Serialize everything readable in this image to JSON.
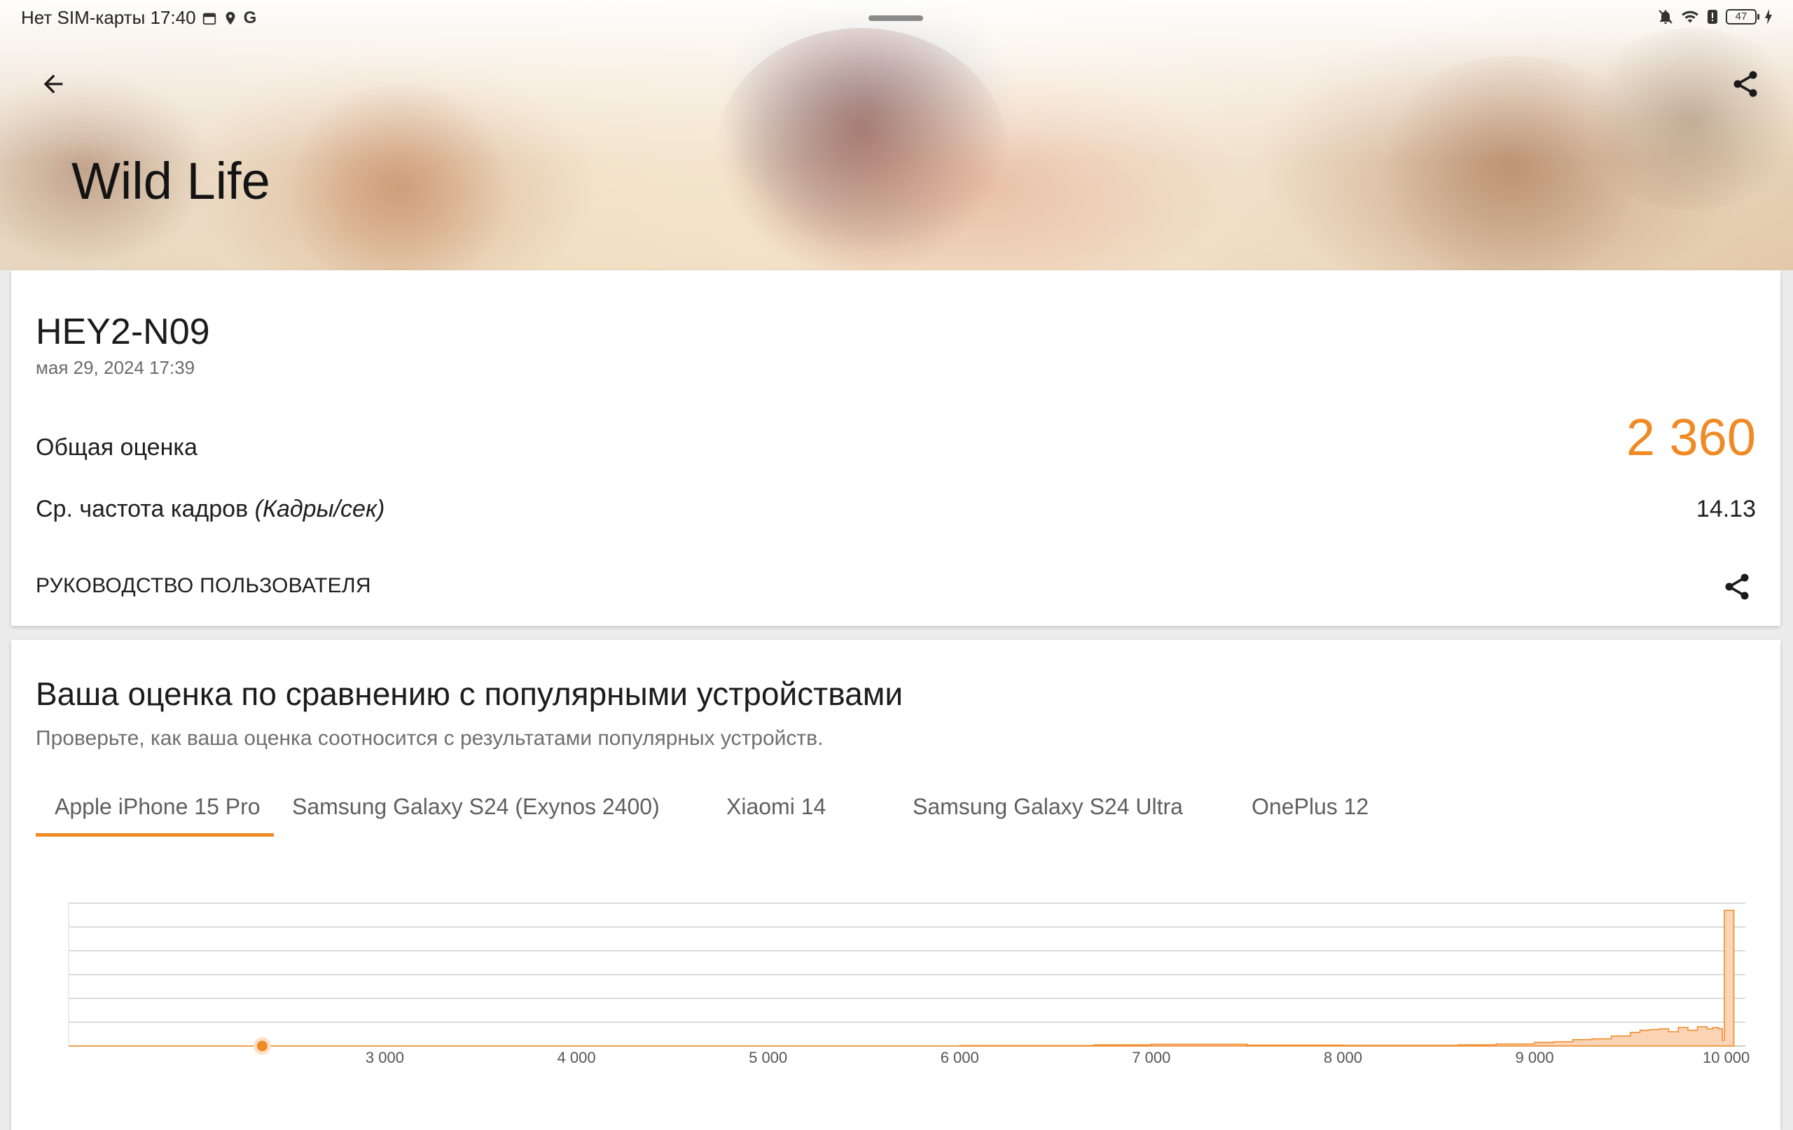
{
  "status_bar": {
    "carrier_time": "Нет SIM-карты 17:40",
    "battery": "47",
    "icons": [
      "calendar-icon",
      "location-icon",
      "google-icon",
      "mute-icon",
      "wifi-icon",
      "alert-icon",
      "battery-icon",
      "charging-icon"
    ]
  },
  "hero": {
    "title": "Wild Life",
    "back_icon": "arrow-left-icon",
    "share_icon": "share-icon"
  },
  "result": {
    "device": "HEY2-N09",
    "date": "мая 29, 2024 17:39",
    "overall_label": "Общая оценка",
    "overall_value": "2 360",
    "fps_label": "Ср. частота кадров",
    "fps_unit": "(Кадры/сек)",
    "fps_value": "14.13",
    "guide_label": "РУКОВОДСТВО ПОЛЬЗОВАТЕЛЯ",
    "accent_color": "#f08a24"
  },
  "comparison": {
    "title": "Ваша оценка по сравнению с популярными устройствами",
    "subtitle": "Проверьте, как ваша оценка соотносится с результатами популярных устройств.",
    "tabs": [
      {
        "label": "Apple iPhone 15 Pro",
        "active": true
      },
      {
        "label": "Samsung Galaxy S24 (Exynos 2400)",
        "active": false
      },
      {
        "label": "Xiaomi 14",
        "active": false
      },
      {
        "label": "Samsung Galaxy S24 Ultra",
        "active": false
      },
      {
        "label": "OnePlus 12",
        "active": false
      }
    ]
  },
  "chart_data": {
    "type": "area",
    "title": "",
    "xlabel": "",
    "ylabel": "",
    "xlim": [
      1350,
      10100
    ],
    "ylim": [
      0,
      1
    ],
    "x_ticks": [
      "3 000",
      "4 000",
      "5 000",
      "6 000",
      "7 000",
      "8 000",
      "9 000",
      "10 000"
    ],
    "x_tick_values": [
      3000,
      4000,
      5000,
      6000,
      7000,
      8000,
      9000,
      10000
    ],
    "gridlines": 6,
    "fill_color": "#fbd3b5",
    "stroke_color": "#f08a24",
    "marker": {
      "score": 2360,
      "color": "#f08a24"
    },
    "series": [
      {
        "x": [
          1350,
          6000,
          6700,
          7000,
          7500,
          8000,
          8600,
          8800,
          9000,
          9100,
          9200,
          9300,
          9400,
          9500,
          9550,
          9600,
          9650,
          9700,
          9750,
          9800,
          9850,
          9900,
          9930,
          9960,
          9980,
          9990,
          10000,
          10020,
          10040
        ],
        "y": [
          0,
          0.003,
          0.008,
          0.012,
          0.006,
          0.004,
          0.008,
          0.014,
          0.025,
          0.03,
          0.045,
          0.05,
          0.07,
          0.095,
          0.11,
          0.115,
          0.12,
          0.1,
          0.13,
          0.11,
          0.135,
          0.12,
          0.13,
          0.12,
          0.04,
          0.95,
          0.95,
          0.95,
          0
        ]
      }
    ]
  }
}
